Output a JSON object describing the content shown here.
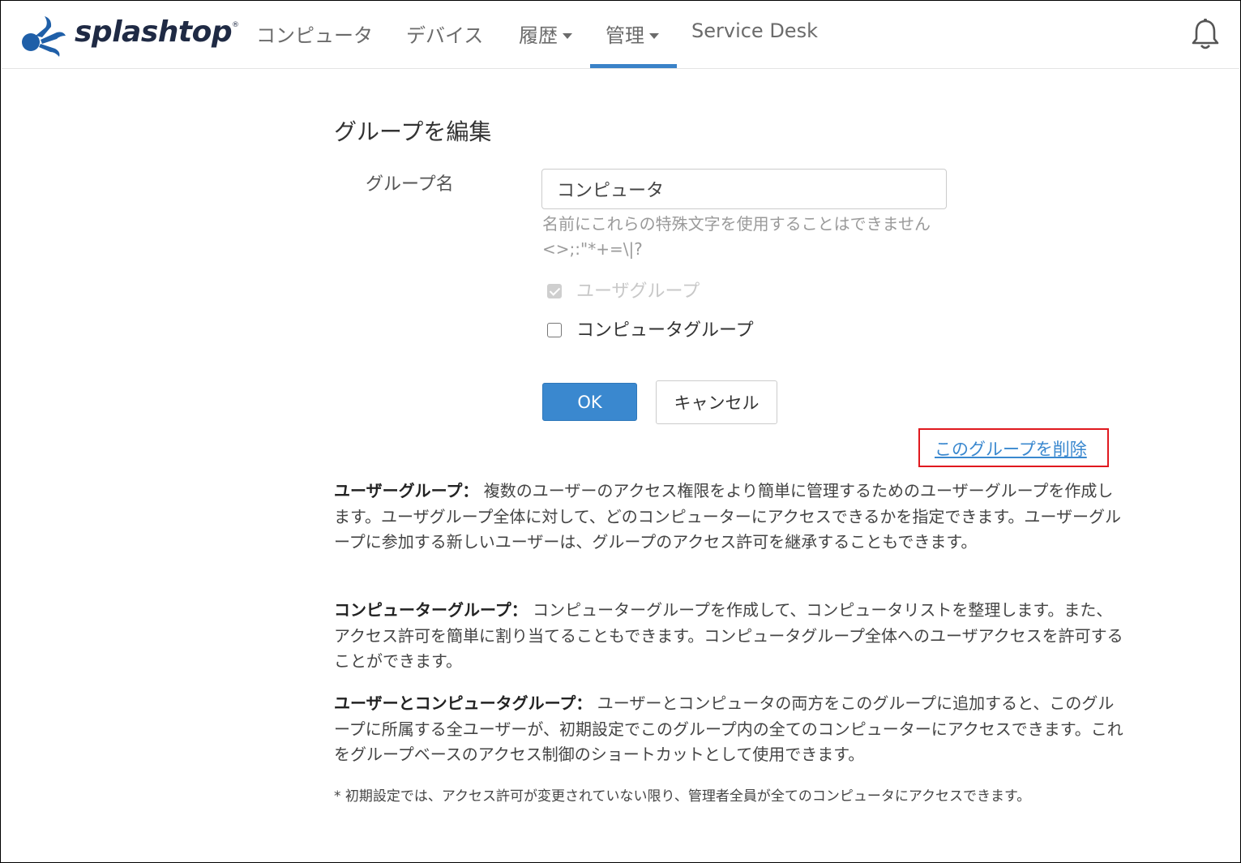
{
  "brand": {
    "name": "splashtop",
    "reg_mark": "®",
    "color": "#1f5fa8"
  },
  "nav": {
    "computers": "コンピュータ",
    "devices": "デバイス",
    "history": "履歴",
    "management": "管理",
    "service_desk": "Service Desk",
    "active": "管理",
    "active_color": "#3a82c8"
  },
  "header": {
    "notification_icon": "bell-icon"
  },
  "form": {
    "title": "グループを編集",
    "group_name_label": "グループ名",
    "group_name_value": "コンピュータ",
    "hint": "名前にこれらの特殊文字を使用することはできません <>;:\"*+=\\|?",
    "checkbox_user_group": {
      "label": "ユーザグループ",
      "checked": true,
      "disabled": true
    },
    "checkbox_computer_group": {
      "label": "コンピュータグループ",
      "checked": false,
      "disabled": false
    },
    "ok_label": "OK",
    "cancel_label": "キャンセル",
    "delete_link": "このグループを削除",
    "primary_color": "#3a88cf",
    "highlight_color": "#e0191f"
  },
  "descriptions": [
    {
      "term": "ユーザーグループ：",
      "text": " 複数のユーザーのアクセス権限をより簡単に管理するためのユーザーグループを作成します。ユーザグループ全体に対して、どのコンピューターにアクセスできるかを指定できます。ユーザーグループに参加する新しいユーザーは、グループのアクセス許可を継承することもできます。"
    },
    {
      "term": "コンピューターグループ：",
      "text": " コンピューターグループを作成して、コンピュータリストを整理します。また、アクセス許可を簡単に割り当てることもできます。コンピュータグループ全体へのユーザアクセスを許可することができます。"
    },
    {
      "term": "ユーザーとコンピュータグループ：",
      "text": " ユーザーとコンピュータの両方をこのグループに追加すると、このグループに所属する全ユーザーが、初期設定でこのグループ内の全てのコンピューターにアクセスできます。これをグループベースのアクセス制御のショートカットとして使用できます。"
    }
  ],
  "footnote": "* 初期設定では、アクセス許可が変更されていない限り、管理者全員が全てのコンピュータにアクセスできます。"
}
